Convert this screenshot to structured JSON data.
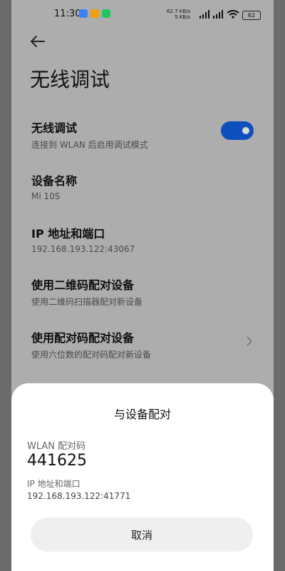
{
  "status_bar": {
    "time": "11:30",
    "speed_up": "62.7 KB/s",
    "speed_down": "5 KB/s",
    "battery": "62",
    "icons": [
      "app-blue-icon",
      "app-orange-icon",
      "app-green-icon",
      "signal-icon",
      "signal-icon",
      "wifi-icon",
      "battery-icon"
    ]
  },
  "header": {
    "title": "无线调试"
  },
  "settings": {
    "wireless_debug": {
      "title": "无线调试",
      "subtitle": "连接到 WLAN 后启用调试模式",
      "enabled": true
    },
    "device_name": {
      "title": "设备名称",
      "value": "Mi 10S"
    },
    "ip_port": {
      "title": "IP 地址和端口",
      "value": "192.168.193.122:43067"
    },
    "qr_pair": {
      "title": "使用二维码配对设备",
      "subtitle": "使用二维码扫描器配对新设备"
    },
    "code_pair": {
      "title": "使用配对码配对设备",
      "subtitle": "使用六位数的配对码配对新设备"
    }
  },
  "dialog": {
    "title": "与设备配对",
    "code_label": "WLAN 配对码",
    "code": "441625",
    "ip_label": "IP 地址和端口",
    "ip_value": "192.168.193.122:41771",
    "cancel_label": "取消"
  },
  "colors": {
    "overlay_bg": "#adadad",
    "toggle_on": "#0d4fbd",
    "sheet_bg": "#ffffff"
  }
}
